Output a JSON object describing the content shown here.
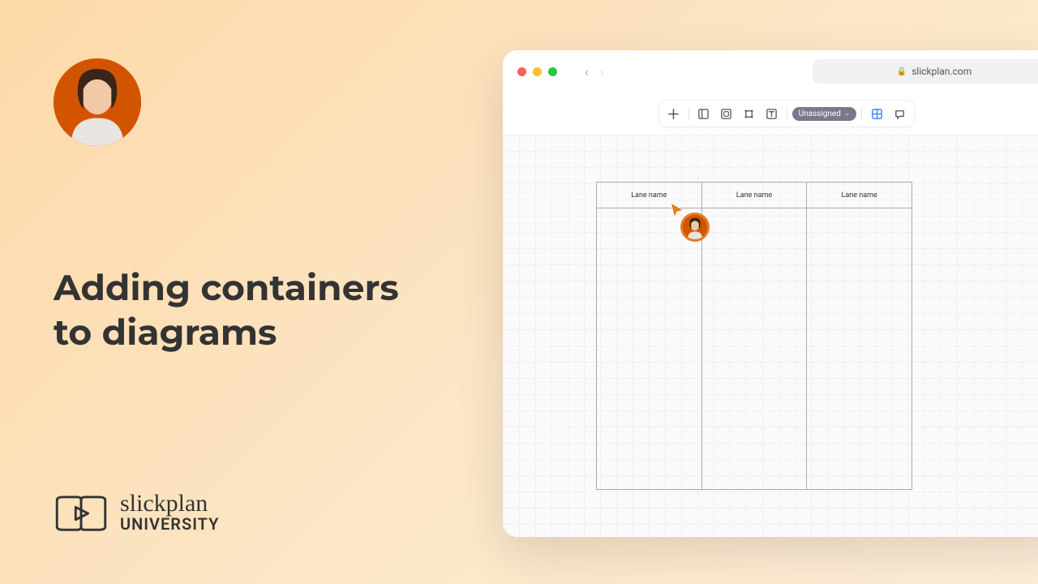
{
  "presenter": {
    "name": "presenter-avatar"
  },
  "title_line1": "Adding containers",
  "title_line2": "to diagrams",
  "brand": {
    "script": "slickplan",
    "uni": "UNIVERSITY"
  },
  "browser": {
    "url": "slickplan.com",
    "toolbar": {
      "unassigned_label": "Unassigned"
    },
    "lanes": [
      "Lane name",
      "Lane name",
      "Lane name"
    ]
  }
}
